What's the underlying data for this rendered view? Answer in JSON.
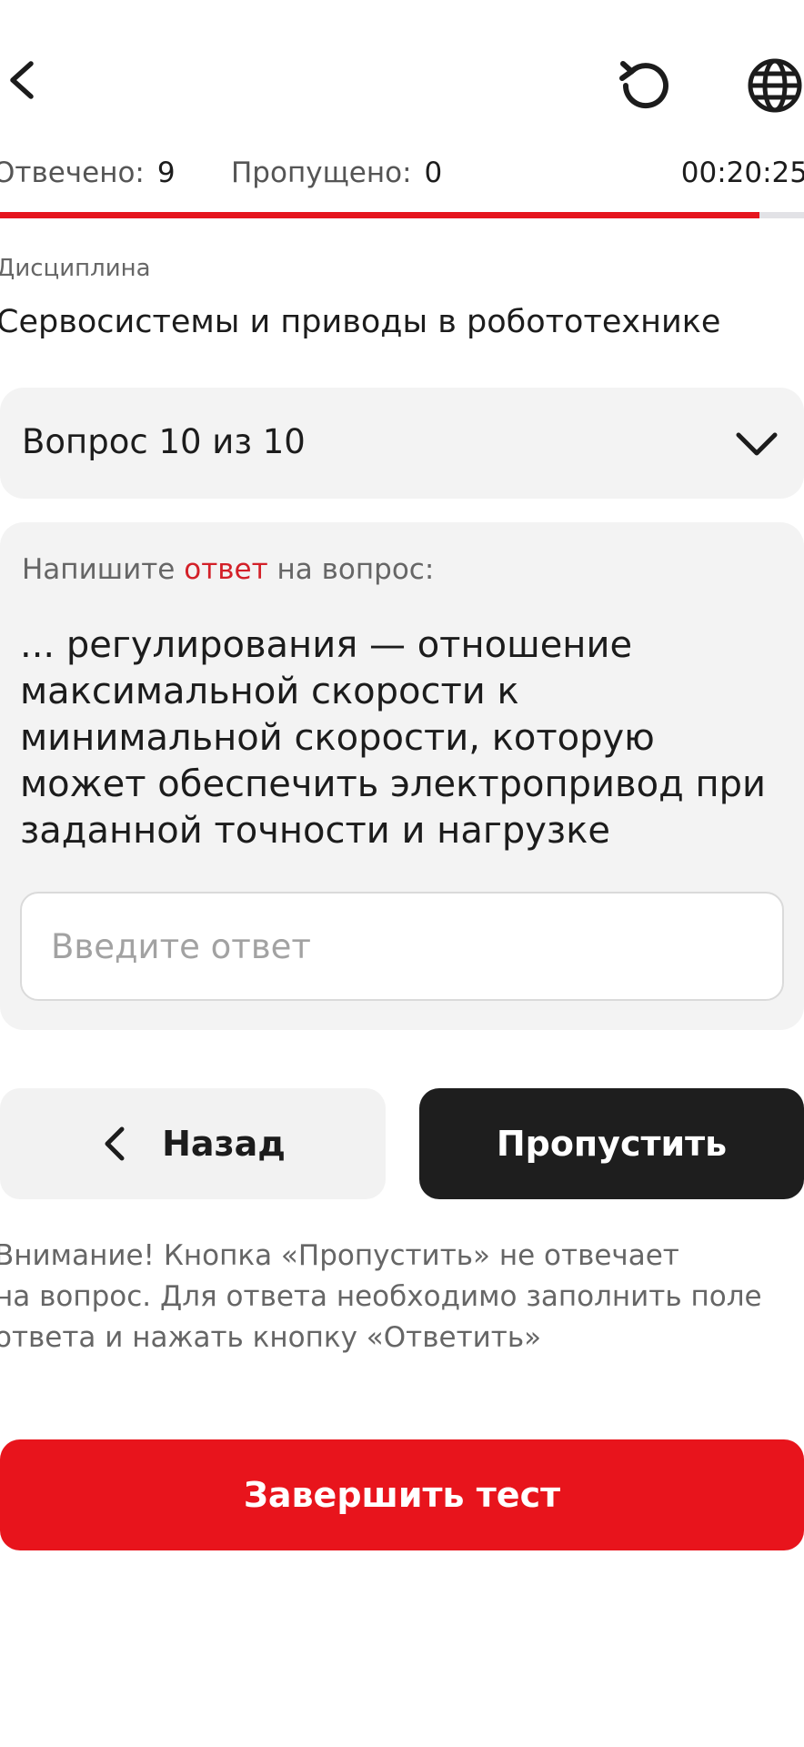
{
  "header": {
    "back_icon": "back-chevron-icon",
    "reset_icon": "restart-icon",
    "language_icon": "globe-icon"
  },
  "stats": {
    "answered_label": "Отвечено:",
    "answered_value": "9",
    "skipped_label": "Пропущено:",
    "skipped_value": "0",
    "timer": "00:20:25"
  },
  "progress": {
    "fraction": 0.945,
    "fill_color": "#e5151e",
    "track_color": "#e2e2e6"
  },
  "discipline": {
    "label": "Дисциплина",
    "value": "Сервосистемы и приводы в робототехнике"
  },
  "question_selector": {
    "label": "Вопрос 10 из 10",
    "icon": "chevron-down-icon"
  },
  "question": {
    "prompt_before": "Напишите ",
    "prompt_accent": "ответ",
    "prompt_after": " на вопрос:",
    "text": "... регулирования — отношение максимальной скорости к минимальной скорости, которую может обеспечить электропривод при заданной точности и нагрузке",
    "input_placeholder": "Введите ответ",
    "input_value": ""
  },
  "buttons": {
    "back_label": "Назад",
    "skip_label": "Пропустить",
    "finish_label": "Завершить тест"
  },
  "notice": {
    "lines": [
      "Внимание! Кнопка «Пропустить» не отвечает",
      "на вопрос. Для ответа необходимо заполнить поле",
      "ответа и нажать кнопку «Ответить»"
    ]
  },
  "colors": {
    "accent_red": "#e8141c",
    "dark_button": "#1e1e1e",
    "card_background": "#f3f3f3"
  }
}
